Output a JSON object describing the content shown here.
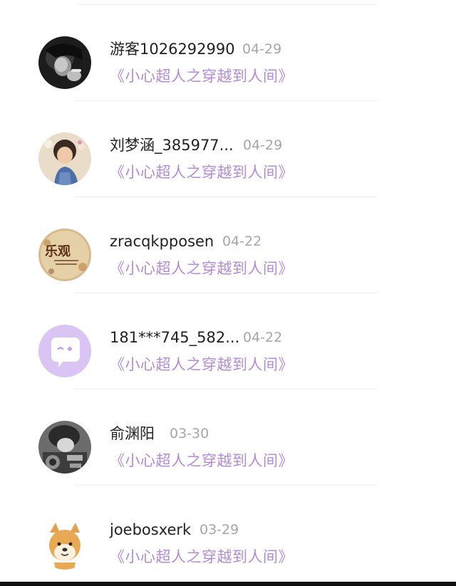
{
  "comments": [
    {
      "user": "游客1026292990",
      "date": "04-29",
      "book": "《小心超人之穿越到人间》",
      "avatar_icon": "bw-portrait-avatar-icon"
    },
    {
      "user": "刘梦涵_385977...",
      "date": "04-29",
      "book": "《小心超人之穿越到人间》",
      "avatar_icon": "girl-photo-avatar-icon"
    },
    {
      "user": "zracqkpposen",
      "date": "04-22",
      "book": "《小心超人之穿越到人间》",
      "avatar_icon": "optimism-badge-avatar-icon",
      "avatar_text": "乐观"
    },
    {
      "user": "181***745_582...",
      "date": "04-22",
      "book": "《小心超人之穿越到人间》",
      "avatar_icon": "default-chat-bubble-avatar-icon"
    },
    {
      "user": "俞渊阳",
      "date": "03-30",
      "book": "《小心超人之穿越到人间》",
      "avatar_icon": "motorbike-photo-avatar-icon"
    },
    {
      "user": "joebosxerk",
      "date": "03-29",
      "book": "《小心超人之穿越到人间》",
      "avatar_icon": "shiba-dog-avatar-icon"
    }
  ],
  "colors": {
    "username": "#222222",
    "date": "#a6a6a6",
    "book_title": "#b58ad8",
    "default_avatar_bg": "#d9c4f3",
    "divider": "#efefef"
  }
}
